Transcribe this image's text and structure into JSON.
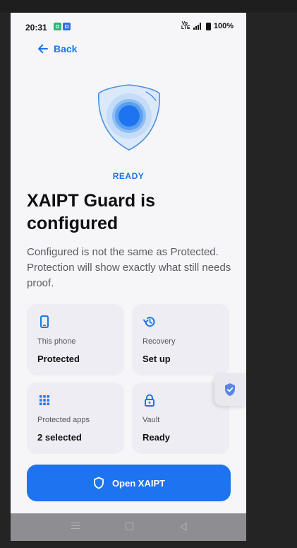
{
  "status_bar": {
    "time": "20:31",
    "volte": "Vo LTE",
    "battery": "100%"
  },
  "header": {
    "back_label": "Back"
  },
  "hero": {
    "status": "READY",
    "title": "XAIPT Guard is configured",
    "subtitle": "Configured is not the same as Protected. Protection will show exactly what still needs proof."
  },
  "cards": [
    {
      "icon": "phone-icon",
      "label": "This phone",
      "value": "Protected"
    },
    {
      "icon": "restore-icon",
      "label": "Recovery",
      "value": "Set up"
    },
    {
      "icon": "apps-grid-icon",
      "label": "Protected apps",
      "value": "2 selected"
    },
    {
      "icon": "lock-icon",
      "label": "Vault",
      "value": "Ready"
    }
  ],
  "cta": {
    "label": "Open XAIPT",
    "icon": "shield-icon"
  },
  "colors": {
    "accent": "#1d74ee",
    "background": "#f6f6f8",
    "card": "#ededf3"
  }
}
